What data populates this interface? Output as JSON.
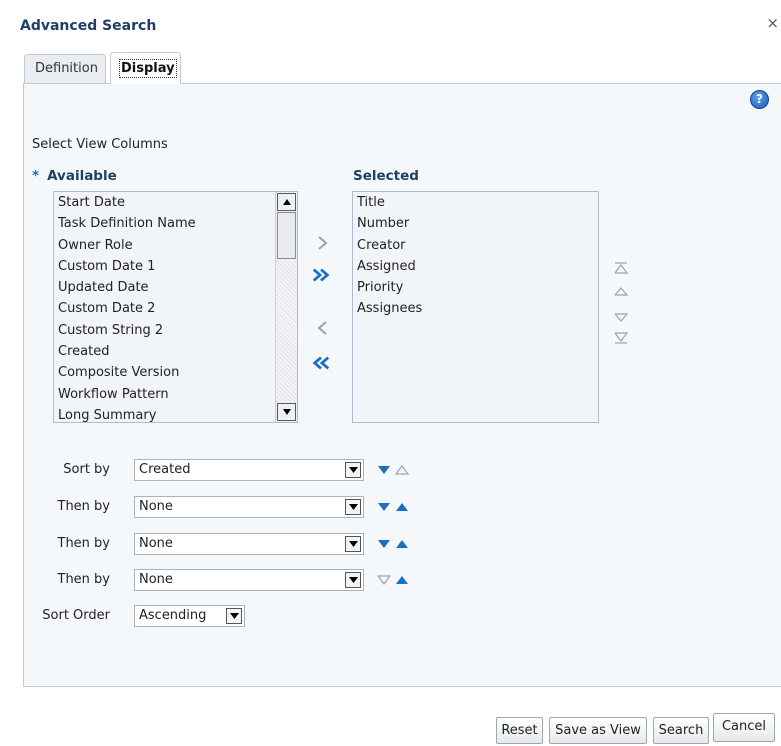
{
  "dialog": {
    "title": "Advanced Search",
    "close_glyph": "×"
  },
  "tabs": [
    {
      "label": "Definition",
      "active": false
    },
    {
      "label": "Display",
      "active": true
    }
  ],
  "help_glyph": "?",
  "columns": {
    "section_label": "Select View Columns",
    "required_marker": "*",
    "available_label": "Available",
    "selected_label": "Selected",
    "available_items": [
      "Start Date",
      "Task Definition Name",
      "Owner Role",
      "Custom Date 1",
      "Updated Date",
      "Custom Date 2",
      "Custom String 2",
      "Created",
      "Composite Version",
      "Workflow Pattern",
      "Long Summary"
    ],
    "selected_items": [
      "Title",
      "Number",
      "Creator",
      "Assigned",
      "Priority",
      "Assignees"
    ]
  },
  "sort": {
    "rows": [
      {
        "label": "Sort by",
        "value": "Created"
      },
      {
        "label": "Then by",
        "value": "None"
      },
      {
        "label": "Then by",
        "value": "None"
      },
      {
        "label": "Then by",
        "value": "None"
      }
    ],
    "order_label": "Sort Order",
    "order_value": "Ascending"
  },
  "buttons": {
    "reset": "Reset",
    "save_as_view": "Save as View",
    "search": "Search",
    "cancel": "Cancel"
  },
  "colors": {
    "accent": "#1c6fc1",
    "title": "#1f3f66",
    "pane": "#f5f8fb",
    "list_bg": "#f1f5fa"
  }
}
